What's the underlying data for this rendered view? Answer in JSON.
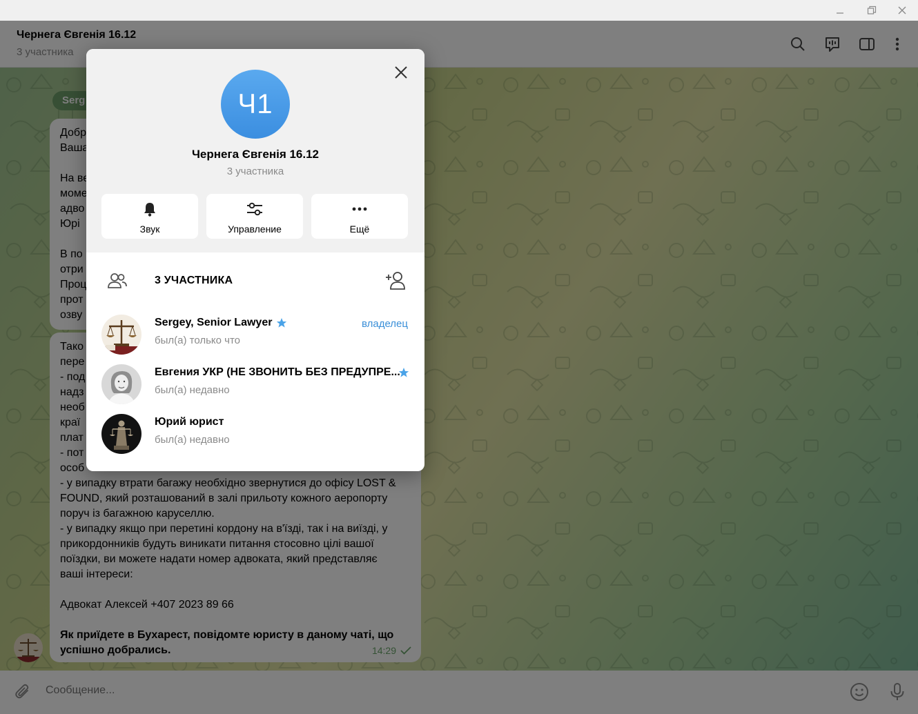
{
  "window": {
    "controls": [
      "minimize",
      "restore",
      "close"
    ]
  },
  "chat": {
    "title": "Чернега Євгенія 16.12",
    "subtitle": "3 участника",
    "sender_label": "Serg",
    "messages": {
      "first": {
        "lines": [
          "Добр",
          "Ваша",
          "",
          "На ве",
          "моме",
          "адво",
          "Юрі",
          "",
          "В по",
          "отри",
          "Проц",
          "прот",
          "озву"
        ]
      },
      "second": {
        "lines_partial": [
          "Тако",
          "пере",
          "- под",
          "надз",
          "необ",
          "краї",
          "плат",
          "- пот",
          "особ"
        ],
        "lines_full": [
          "- у випадку втрати багажу необхідно звернутися до офісу LOST &",
          "FOUND, який розташований в залі прильоту кожного аеропорту",
          "поруч із багажною каруселлю.",
          "- у випадку якщо при перетині кордону на в'їзді, так і на виїзді, у",
          "прикордонників будуть виникати питання стосовно цілі вашої",
          "поїздки, ви можете надати номер адвоката, який представляє",
          "ваші інтереси:",
          "",
          "Адвокат Алексей +407 2023 89 66",
          ""
        ],
        "bold_text": "Як приїдете в Бухарест, повідомте юристу в даному чаті, що успішно добрались.",
        "time": "14:29"
      }
    },
    "composer_placeholder": "Сообщение..."
  },
  "modal": {
    "avatar_initials": "Ч1",
    "title": "Чернега Євгенія 16.12",
    "subtitle": "3 участника",
    "actions": {
      "sound": "Звук",
      "manage": "Управление",
      "more": "Ещё"
    },
    "members_header": "3 УЧАСТНИКА",
    "members": [
      {
        "name": "Sergey, Senior Lawyer",
        "status": "был(а) только что",
        "role": "владелец"
      },
      {
        "name": "Евгения УКР (НЕ ЗВОНИТЬ БЕЗ ПРЕДУПРЕ...",
        "status": "был(а) недавно",
        "role": ""
      },
      {
        "name": "Юрий юрист",
        "status": "был(а) недавно",
        "role": ""
      }
    ]
  },
  "colors": {
    "accent": "#3a8fd8",
    "avatar_blue": "#4a9ce8",
    "star": "#4aa3e8",
    "time_green": "#6aa56a"
  }
}
